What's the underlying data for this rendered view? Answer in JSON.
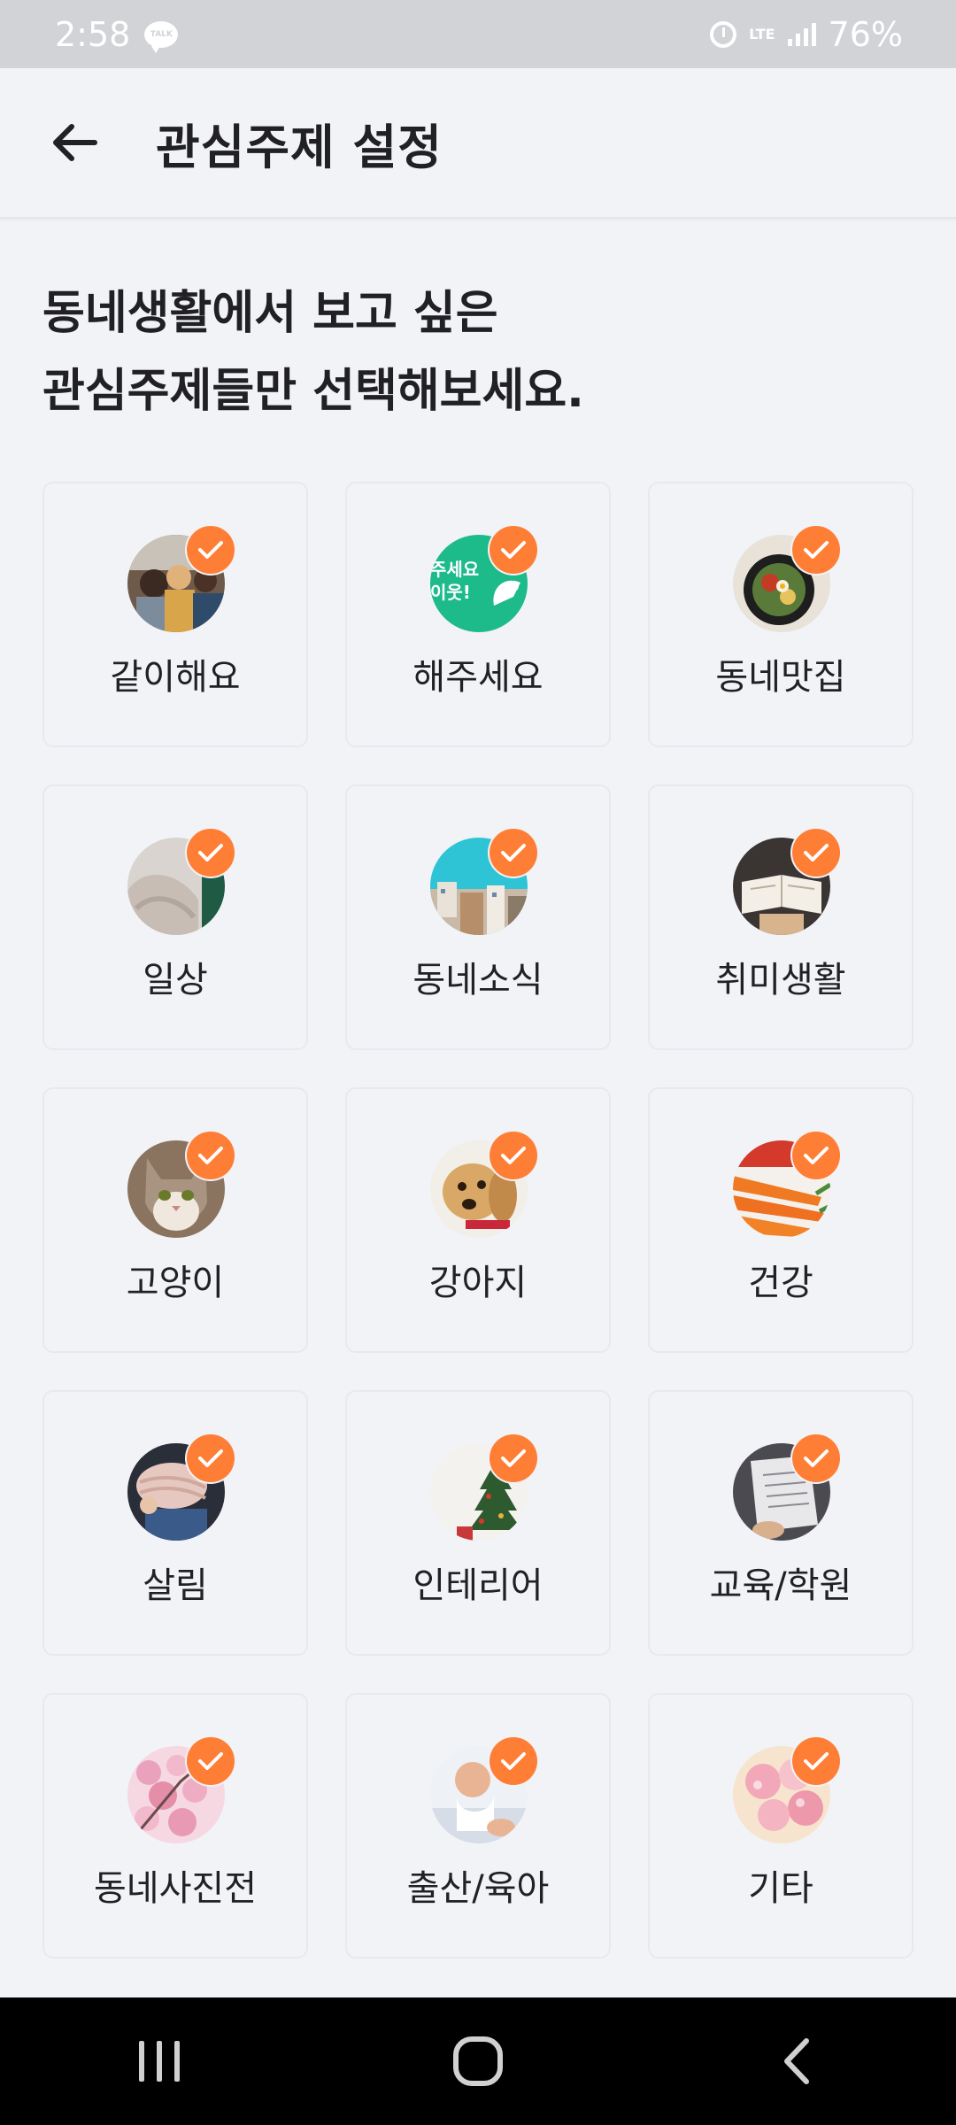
{
  "status_bar": {
    "time": "2:58",
    "chat_app_label": "TALK",
    "network": "LTE",
    "battery": "76%"
  },
  "header": {
    "title": "관심주제 설정",
    "back_icon": "arrow-left-icon"
  },
  "headline": {
    "line1": "동네생활에서 보고 싶은",
    "line2": "관심주제들만 선택해보세요."
  },
  "accent_color": "#ff7e36",
  "topics": [
    {
      "label": "같이해요",
      "selected": true
    },
    {
      "label": "해주세요",
      "selected": true,
      "thumb_text": [
        "주세요",
        "이웃!"
      ]
    },
    {
      "label": "동네맛집",
      "selected": true
    },
    {
      "label": "일상",
      "selected": true
    },
    {
      "label": "동네소식",
      "selected": true
    },
    {
      "label": "취미생활",
      "selected": true
    },
    {
      "label": "고양이",
      "selected": true
    },
    {
      "label": "강아지",
      "selected": true
    },
    {
      "label": "건강",
      "selected": true
    },
    {
      "label": "살림",
      "selected": true
    },
    {
      "label": "인테리어",
      "selected": true
    },
    {
      "label": "교육/학원",
      "selected": true
    },
    {
      "label": "동네사진전",
      "selected": true
    },
    {
      "label": "출산/육아",
      "selected": true
    },
    {
      "label": "기타",
      "selected": true
    }
  ]
}
